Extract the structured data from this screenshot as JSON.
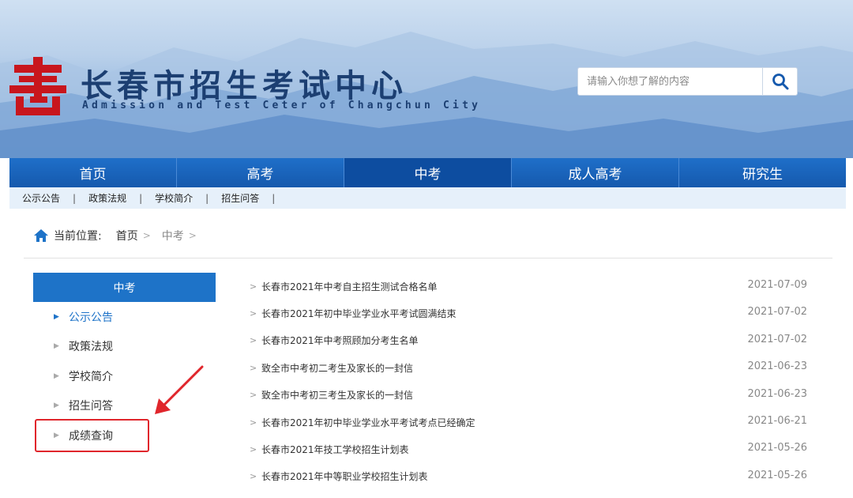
{
  "header": {
    "title": "长春市招生考试中心",
    "subtitle": "Admission and Test Ceter of Changchun City",
    "logo_icon": "logo-icon"
  },
  "search": {
    "placeholder": "请输入你想了解的内容",
    "icon": "search-icon"
  },
  "nav": {
    "items": [
      {
        "label": "首页"
      },
      {
        "label": "高考"
      },
      {
        "label": "中考"
      },
      {
        "label": "成人高考"
      },
      {
        "label": "研究生"
      }
    ],
    "active_index": 2
  },
  "subnav": {
    "items": [
      {
        "label": "公示公告"
      },
      {
        "label": "政策法规"
      },
      {
        "label": "学校简介"
      },
      {
        "label": "招生问答"
      }
    ],
    "separator": "|"
  },
  "breadcrumb": {
    "prefix": "当前位置:",
    "items": [
      {
        "label": "首页"
      },
      {
        "label": "中考"
      }
    ],
    "separator": ">"
  },
  "sidebar": {
    "heading": "中考",
    "items": [
      {
        "label": "公示公告"
      },
      {
        "label": "政策法规"
      },
      {
        "label": "学校简介"
      },
      {
        "label": "招生问答"
      },
      {
        "label": "成绩查询"
      }
    ],
    "active_index": 0,
    "highlighted_index": 4
  },
  "news": {
    "items": [
      {
        "title": "长春市2021年中考自主招生测试合格名单",
        "date": "2021-07-09"
      },
      {
        "title": "长春市2021年初中毕业学业水平考试圆满结束",
        "date": "2021-07-02"
      },
      {
        "title": "长春市2021年中考照顾加分考生名单",
        "date": "2021-07-02"
      },
      {
        "title": "致全市中考初二考生及家长的一封信",
        "date": "2021-06-23"
      },
      {
        "title": "致全市中考初三考生及家长的一封信",
        "date": "2021-06-23"
      },
      {
        "title": "长春市2021年初中毕业学业水平考试考点已经确定",
        "date": "2021-06-21"
      },
      {
        "title": "长春市2021年技工学校招生计划表",
        "date": "2021-05-26"
      },
      {
        "title": "长春市2021年中等职业学校招生计划表",
        "date": "2021-05-26"
      }
    ]
  },
  "colors": {
    "nav_blue": "#1559ad",
    "nav_active": "#0d4da0",
    "accent": "#1e73c8",
    "logo_red": "#c8161d",
    "annotation_red": "#e0262c"
  }
}
